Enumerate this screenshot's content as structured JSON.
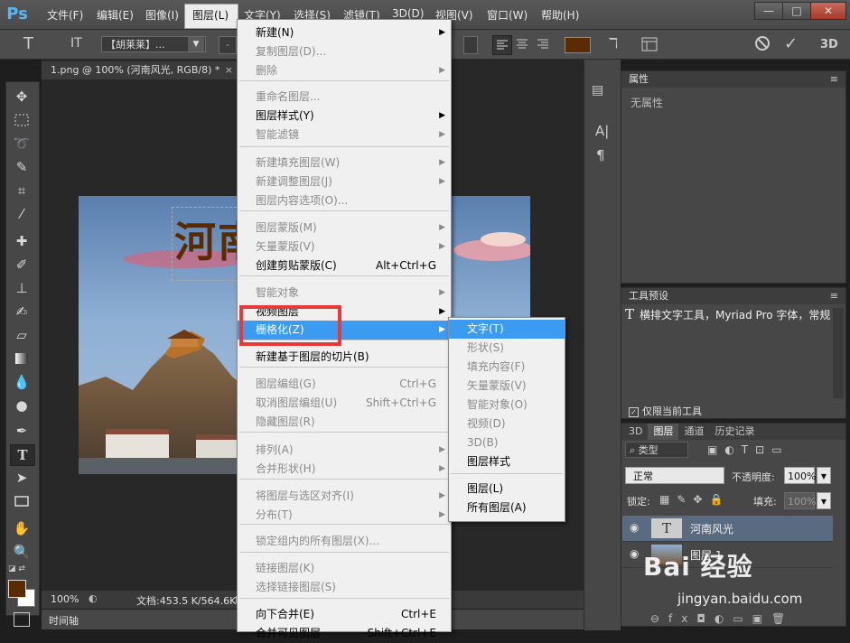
{
  "app": {
    "logo": "Ps"
  },
  "menubar": {
    "items": [
      "文件(F)",
      "编辑(E)",
      "图像(I)",
      "图层(L)",
      "文字(Y)",
      "选择(S)",
      "滤镜(T)",
      "3D(D)",
      "视图(V)",
      "窗口(W)",
      "帮助(H)"
    ],
    "window_controls": [
      "—",
      "□",
      "✕"
    ]
  },
  "options_bar": {
    "tool_icon": "T",
    "orientation_icon": "IT",
    "font_family": "【胡莱莱】...",
    "font_style": "-",
    "cancel_icon": "⃠",
    "commit_icon": "✓",
    "mode_3d": "3D",
    "text_color": "#5b2b00"
  },
  "document": {
    "tab_label": "1.png @ 100% (河南风光, RGB/8) *",
    "tab_close": "×",
    "text_layer_content": "河南",
    "zoom": "100%",
    "doc_size": "文档:453.5 K/564.6K",
    "timeline_label": "时间轴"
  },
  "layer_menu": {
    "items": [
      {
        "label": "新建(N)",
        "shortcut": "",
        "submenu": true,
        "disabled": false
      },
      {
        "label": "复制图层(D)...",
        "shortcut": "",
        "submenu": false,
        "disabled": true
      },
      {
        "label": "删除",
        "shortcut": "",
        "submenu": true,
        "disabled": true
      },
      {
        "label": "重命名图层...",
        "shortcut": "",
        "submenu": false,
        "disabled": true
      },
      {
        "label": "图层样式(Y)",
        "shortcut": "",
        "submenu": true,
        "disabled": false
      },
      {
        "label": "智能滤镜",
        "shortcut": "",
        "submenu": true,
        "disabled": true
      },
      {
        "label": "新建填充图层(W)",
        "shortcut": "",
        "submenu": true,
        "disabled": true
      },
      {
        "label": "新建调整图层(J)",
        "shortcut": "",
        "submenu": true,
        "disabled": true
      },
      {
        "label": "图层内容选项(O)...",
        "shortcut": "",
        "submenu": false,
        "disabled": true
      },
      {
        "label": "图层蒙版(M)",
        "shortcut": "",
        "submenu": true,
        "disabled": true
      },
      {
        "label": "矢量蒙版(V)",
        "shortcut": "",
        "submenu": true,
        "disabled": true
      },
      {
        "label": "创建剪贴蒙版(C)",
        "shortcut": "Alt+Ctrl+G",
        "submenu": false,
        "disabled": false
      },
      {
        "label": "智能对象",
        "shortcut": "",
        "submenu": true,
        "disabled": true
      },
      {
        "label": "视频图层",
        "shortcut": "",
        "submenu": true,
        "disabled": false
      },
      {
        "label": "栅格化(Z)",
        "shortcut": "",
        "submenu": true,
        "disabled": false
      },
      {
        "label": "新建基于图层的切片(B)",
        "shortcut": "",
        "submenu": false,
        "disabled": false
      },
      {
        "label": "图层编组(G)",
        "shortcut": "Ctrl+G",
        "submenu": false,
        "disabled": true
      },
      {
        "label": "取消图层编组(U)",
        "shortcut": "Shift+Ctrl+G",
        "submenu": false,
        "disabled": true
      },
      {
        "label": "隐藏图层(R)",
        "shortcut": "",
        "submenu": false,
        "disabled": true
      },
      {
        "label": "排列(A)",
        "shortcut": "",
        "submenu": true,
        "disabled": true
      },
      {
        "label": "合并形状(H)",
        "shortcut": "",
        "submenu": true,
        "disabled": true
      },
      {
        "label": "将图层与选区对齐(I)",
        "shortcut": "",
        "submenu": true,
        "disabled": true
      },
      {
        "label": "分布(T)",
        "shortcut": "",
        "submenu": true,
        "disabled": true
      },
      {
        "label": "锁定组内的所有图层(X)...",
        "shortcut": "",
        "submenu": false,
        "disabled": true
      },
      {
        "label": "链接图层(K)",
        "shortcut": "",
        "submenu": false,
        "disabled": true
      },
      {
        "label": "选择链接图层(S)",
        "shortcut": "",
        "submenu": false,
        "disabled": true
      },
      {
        "label": "向下合并(E)",
        "shortcut": "Ctrl+E",
        "submenu": false,
        "disabled": false
      },
      {
        "label": "合并可见图层",
        "shortcut": "Shift+Ctrl+E",
        "submenu": false,
        "disabled": false
      }
    ]
  },
  "rasterize_submenu": {
    "items": [
      {
        "label": "文字(T)",
        "disabled": false
      },
      {
        "label": "形状(S)",
        "disabled": true
      },
      {
        "label": "填充内容(F)",
        "disabled": true
      },
      {
        "label": "矢量蒙版(V)",
        "disabled": true
      },
      {
        "label": "智能对象(O)",
        "disabled": true
      },
      {
        "label": "视频(D)",
        "disabled": true
      },
      {
        "label": "3D(B)",
        "disabled": true
      },
      {
        "label": "图层样式",
        "disabled": false
      },
      {
        "label": "图层(L)",
        "disabled": false
      },
      {
        "label": "所有图层(A)",
        "disabled": false
      }
    ]
  },
  "properties_panel": {
    "title": "属性",
    "content": "无属性"
  },
  "tool_presets_panel": {
    "title": "工具预设",
    "item": "横排文字工具，Myriad Pro 字体，常规",
    "checkbox_label": "仅限当前工具"
  },
  "layers_panel": {
    "tabs": [
      "3D",
      "图层",
      "通道",
      "历史记录"
    ],
    "active_tab": "图层",
    "filter_label": "类型",
    "blend_mode": "正常",
    "opacity_label": "不透明度:",
    "opacity_value": "100%",
    "lock_label": "锁定:",
    "fill_label": "填充:",
    "fill_value": "100%",
    "layers": [
      {
        "name": "河南风光",
        "type": "text",
        "thumb": "T",
        "selected": true
      },
      {
        "name": "图层 1",
        "type": "image",
        "thumb": "",
        "selected": false
      }
    ]
  },
  "watermark": {
    "brand": "Bai 经验",
    "url": "jingyan.baidu.com"
  }
}
